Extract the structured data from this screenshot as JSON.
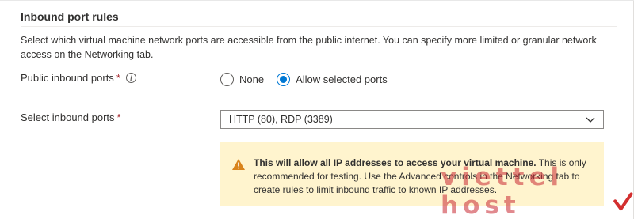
{
  "section": {
    "title": "Inbound port rules",
    "description": "Select which virtual machine network ports are accessible from the public internet. You can specify more limited or granular network access on the Networking tab."
  },
  "public_inbound_ports": {
    "label": "Public inbound ports",
    "required_marker": "*",
    "info_icon": "info-icon",
    "options": [
      {
        "label": "None",
        "selected": false
      },
      {
        "label": "Allow selected ports",
        "selected": true
      }
    ]
  },
  "select_inbound_ports": {
    "label": "Select inbound ports",
    "required_marker": "*",
    "value": "HTTP (80), RDP (3389)",
    "icon": "chevron-down-icon"
  },
  "warning": {
    "icon": "warning-icon",
    "bold_text": "This will allow all IP addresses to access your virtual machine.",
    "text": "This is only recommended for testing.  Use the Advanced controls in the Networking tab to create rules to limit inbound traffic to known IP addresses."
  },
  "watermark": {
    "text": "viettel host",
    "icon": "check-mark-icon"
  },
  "colors": {
    "accent": "#0078d4",
    "required": "#a4262c",
    "warning_bg": "#fff4ce",
    "warning_icon": "#d9841c"
  }
}
